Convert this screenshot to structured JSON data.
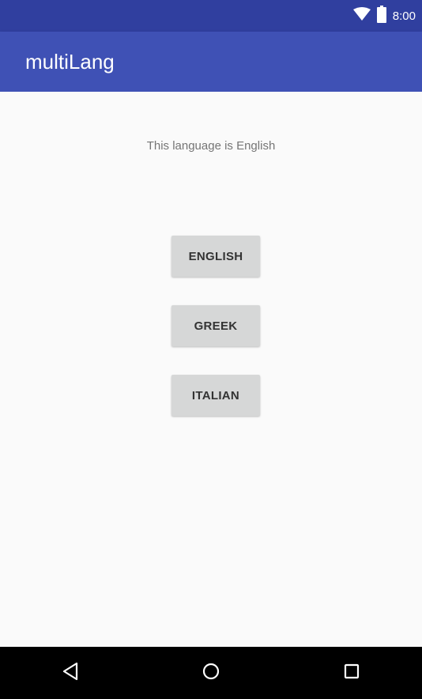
{
  "status_bar": {
    "time": "8:00",
    "icons": [
      "wifi-icon",
      "battery-icon"
    ],
    "background": "#303f9f"
  },
  "app_bar": {
    "title": "multiLang",
    "background": "#3f51b5"
  },
  "main": {
    "language_text": "This language is English",
    "buttons": [
      {
        "label": "ENGLISH"
      },
      {
        "label": "GREEK"
      },
      {
        "label": "ITALIAN"
      }
    ]
  },
  "nav_bar": {
    "icons": [
      "back-icon",
      "home-icon",
      "recents-icon"
    ],
    "background": "#000000"
  }
}
